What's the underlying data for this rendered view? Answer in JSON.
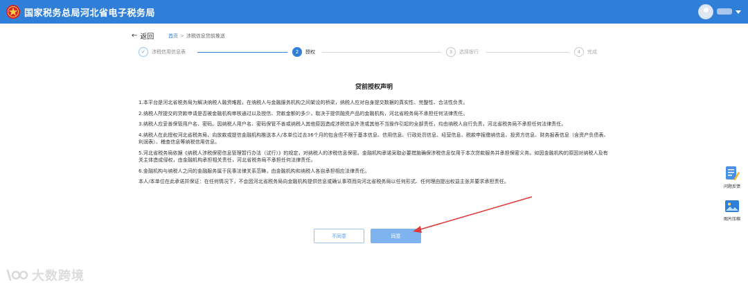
{
  "header": {
    "brand": "国家税务总局河北省电子税务局",
    "logo": "tax-emblem-icon",
    "avatar": "user-avatar-icon",
    "colors": {
      "bar": "#2f7fd8",
      "emblem": "#d8232a"
    }
  },
  "nav": {
    "back_arrow": "←",
    "back_label": "返回",
    "breadcrumb": {
      "home": "首页",
      "separator": ">",
      "current": "涉税信息贷前推送"
    }
  },
  "steps": [
    {
      "number": "✓",
      "label": "涉税信用信息表",
      "state": "done"
    },
    {
      "number": "2",
      "label": "授权",
      "state": "active"
    },
    {
      "number": "3",
      "label": "选择银行",
      "state": "pending"
    },
    {
      "number": "4",
      "label": "完成",
      "state": "pending"
    }
  ],
  "document": {
    "title": "贷前授权声明",
    "paragraphs": [
      "1.本平台是河北省税务局为解决纳税人融资难题，在纳税人与金融服务机构之间架设的桥梁，纳税人应对自身提交数据的真实性、完整性、合法性负责。",
      "2.纳税人所提交的贷款申请是否被金融机构审核通过以及授信、贷款金额的多少，取决于提供融资产品的金融机构，河北省税务局不承担任何法律责任。",
      "3.纳税人应妥善保管用户名、密码。因纳税人用户名、密码保管不善或纳税人其他原因造成涉税信息外泄或其他不当操作引起的全部责任，均由纳税人自行负责，河北省税务局不承担任何法律责任。",
      "4.纳税人在此授权河北省税务局，向放款或提信金融机构推送本人/本单位过去36个月的包含但不限于基本信息、信用信息、行政处罚信息、经营信息、税款申报缴纳信息、投资方信息、财务报表信息（含资产负债表、利润表）、稽查信息等纳税信用信息。",
      "5.河北省税务局依据《纳税人涉税保密信息管理暂行办法（试行）》的规定，对纳税人的涉税信息保密。金融机构承诺采取必要措施确保涉税信息仅用于本次贷款服务并承担保密义务。如因金融机构的原因对纳税人及有关主体造成侵权，由金融机构承担相关责任，河北省税务局不承担任何法律责任。",
      "6.金融机构与纳税人之间的金融服务属于民事法律关系范畴，由金融机构和纳税人各自承担相应法律责任。",
      "本人/本单位在此承诺并保证：在任何情况下，不会因河北省税务局向金融机构提供信息或确认事项而向河北省税务局以任何形式、任何理由提出权益主张并要求承担责任。"
    ]
  },
  "actions": {
    "disagree": "不同意",
    "agree": "同意"
  },
  "side_tools": [
    {
      "label": "问题反馈",
      "icon": "feedback-edit-icon"
    },
    {
      "label": "图片压缩",
      "icon": "image-compress-icon"
    }
  ],
  "watermark": {
    "text": "大数跨境",
    "icon": "watermark-logo-icon"
  },
  "annotation": {
    "color": "#e03a3a"
  }
}
